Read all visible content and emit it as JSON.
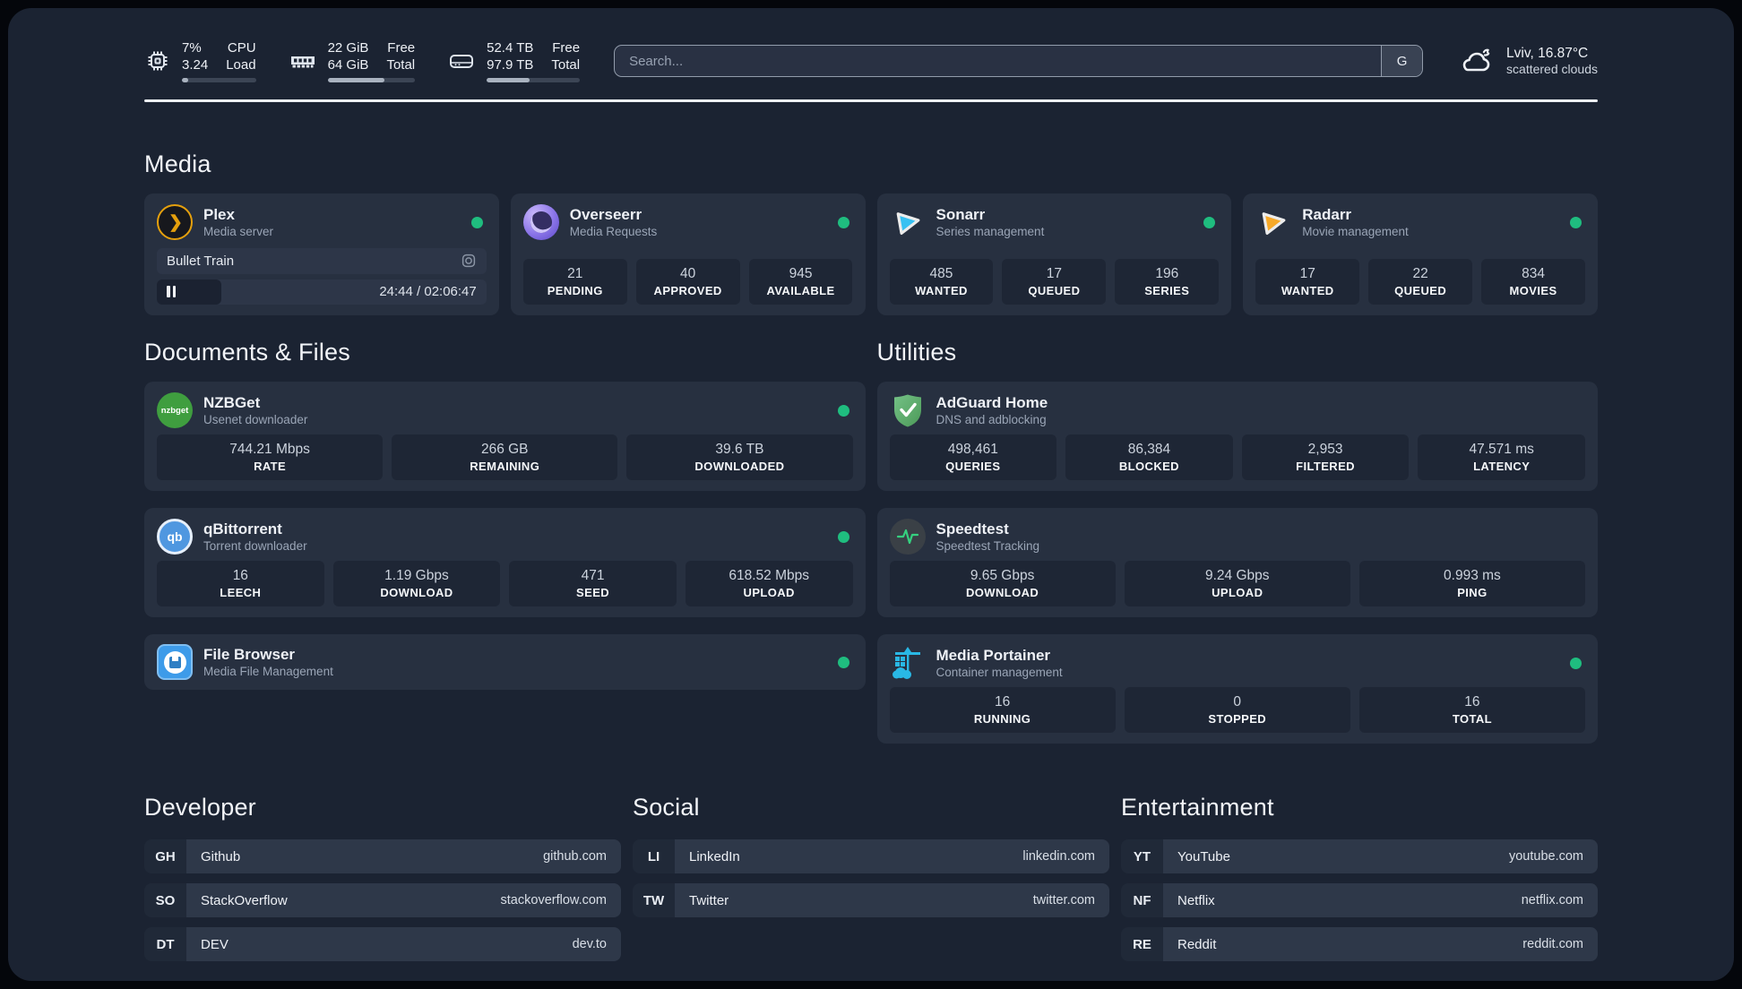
{
  "topbar": {
    "stats": [
      {
        "icon": "cpu-icon",
        "value_top": "7%",
        "value_bottom": "3.24",
        "label_top": "CPU",
        "label_bottom": "Load",
        "progress_pct": 8
      },
      {
        "icon": "memory-icon",
        "value_top": "22 GiB",
        "value_bottom": "64 GiB",
        "label_top": "Free",
        "label_bottom": "Total",
        "progress_pct": 65
      },
      {
        "icon": "disk-icon",
        "value_top": "52.4 TB",
        "value_bottom": "97.9 TB",
        "label_top": "Free",
        "label_bottom": "Total",
        "progress_pct": 46
      }
    ],
    "search": {
      "placeholder": "Search...",
      "engine_label": "G"
    },
    "weather": {
      "location_temp": "Lviv, 16.87°C",
      "condition": "scattered clouds"
    }
  },
  "media": {
    "title": "Media",
    "plex": {
      "name": "Plex",
      "subtitle": "Media server",
      "now_playing": {
        "title": "Bullet Train",
        "time": "24:44 / 02:06:47",
        "progress_pct": 19.5
      }
    },
    "apps": [
      {
        "name": "Overseerr",
        "subtitle": "Media Requests",
        "stats": [
          {
            "value": "21",
            "label": "PENDING"
          },
          {
            "value": "40",
            "label": "APPROVED"
          },
          {
            "value": "945",
            "label": "AVAILABLE"
          }
        ]
      },
      {
        "name": "Sonarr",
        "subtitle": "Series management",
        "stats": [
          {
            "value": "485",
            "label": "WANTED"
          },
          {
            "value": "17",
            "label": "QUEUED"
          },
          {
            "value": "196",
            "label": "SERIES"
          }
        ]
      },
      {
        "name": "Radarr",
        "subtitle": "Movie management",
        "stats": [
          {
            "value": "17",
            "label": "WANTED"
          },
          {
            "value": "22",
            "label": "QUEUED"
          },
          {
            "value": "834",
            "label": "MOVIES"
          }
        ]
      }
    ]
  },
  "documents": {
    "title": "Documents & Files",
    "apps": [
      {
        "name": "NZBGet",
        "subtitle": "Usenet downloader",
        "stats": [
          {
            "value": "744.21 Mbps",
            "label": "RATE"
          },
          {
            "value": "266 GB",
            "label": "REMAINING"
          },
          {
            "value": "39.6 TB",
            "label": "DOWNLOADED"
          }
        ]
      },
      {
        "name": "qBittorrent",
        "subtitle": "Torrent downloader",
        "stats": [
          {
            "value": "16",
            "label": "LEECH"
          },
          {
            "value": "1.19 Gbps",
            "label": "DOWNLOAD"
          },
          {
            "value": "471",
            "label": "SEED"
          },
          {
            "value": "618.52 Mbps",
            "label": "UPLOAD"
          }
        ]
      },
      {
        "name": "File Browser",
        "subtitle": "Media File Management",
        "stats": []
      }
    ]
  },
  "utilities": {
    "title": "Utilities",
    "apps": [
      {
        "name": "AdGuard Home",
        "subtitle": "DNS and adblocking",
        "stats": [
          {
            "value": "498,461",
            "label": "QUERIES"
          },
          {
            "value": "86,384",
            "label": "BLOCKED"
          },
          {
            "value": "2,953",
            "label": "FILTERED"
          },
          {
            "value": "47.571 ms",
            "label": "LATENCY"
          }
        ]
      },
      {
        "name": "Speedtest",
        "subtitle": "Speedtest Tracking",
        "stats": [
          {
            "value": "9.65 Gbps",
            "label": "DOWNLOAD"
          },
          {
            "value": "9.24 Gbps",
            "label": "UPLOAD"
          },
          {
            "value": "0.993 ms",
            "label": "PING"
          }
        ]
      },
      {
        "name": "Media Portainer",
        "subtitle": "Container management",
        "stats": [
          {
            "value": "16",
            "label": "RUNNING"
          },
          {
            "value": "0",
            "label": "STOPPED"
          },
          {
            "value": "16",
            "label": "TOTAL"
          }
        ]
      }
    ]
  },
  "links": {
    "developer": {
      "title": "Developer",
      "items": [
        {
          "tag": "GH",
          "name": "Github",
          "url": "github.com"
        },
        {
          "tag": "SO",
          "name": "StackOverflow",
          "url": "stackoverflow.com"
        },
        {
          "tag": "DT",
          "name": "DEV",
          "url": "dev.to"
        }
      ]
    },
    "social": {
      "title": "Social",
      "items": [
        {
          "tag": "LI",
          "name": "LinkedIn",
          "url": "linkedin.com"
        },
        {
          "tag": "TW",
          "name": "Twitter",
          "url": "twitter.com"
        }
      ]
    },
    "entertainment": {
      "title": "Entertainment",
      "items": [
        {
          "tag": "YT",
          "name": "YouTube",
          "url": "youtube.com"
        },
        {
          "tag": "NF",
          "name": "Netflix",
          "url": "netflix.com"
        },
        {
          "tag": "RE",
          "name": "Reddit",
          "url": "reddit.com"
        }
      ]
    }
  },
  "colors": {
    "status_online": "#1fbd7f",
    "panel_bg": "#1b2332",
    "card_bg": "#273040",
    "plex_accent": "#e5a00d",
    "sonarr_accent": "#38c1f2",
    "radarr_accent": "#f7a928",
    "portainer_accent": "#29b8e5"
  }
}
